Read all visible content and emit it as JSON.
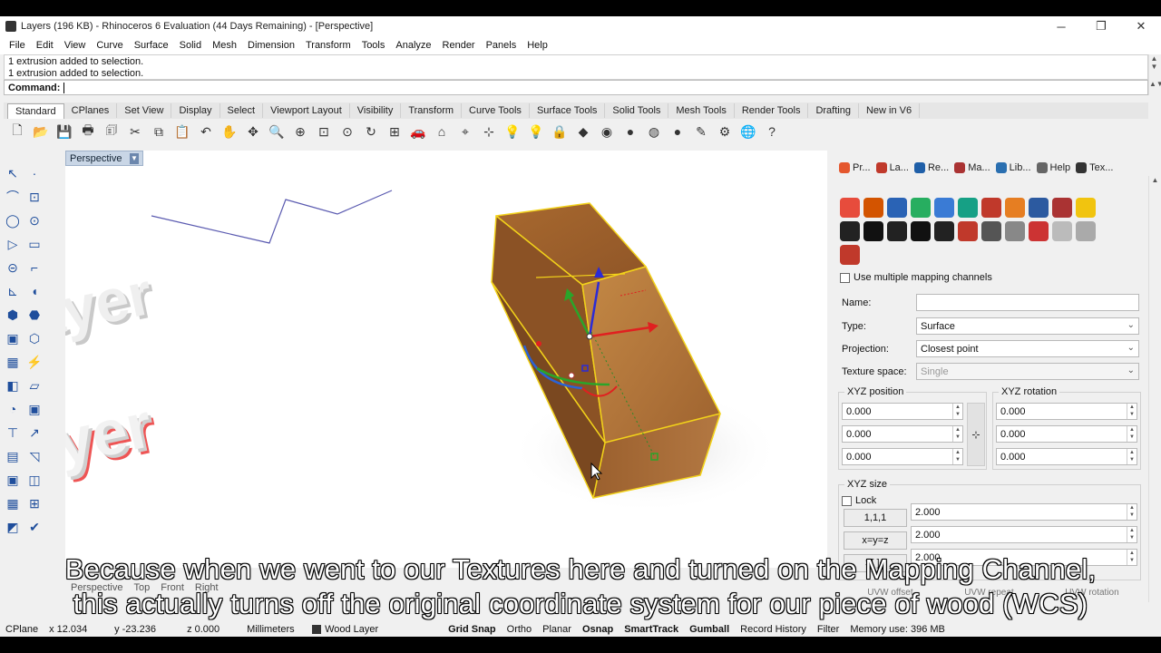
{
  "window": {
    "title": "Layers (196 KB) - Rhinoceros 6 Evaluation (44 Days Remaining) - [Perspective]",
    "minimize": "─",
    "maximize": "❐",
    "close": "✕"
  },
  "menu": [
    "File",
    "Edit",
    "View",
    "Curve",
    "Surface",
    "Solid",
    "Mesh",
    "Dimension",
    "Transform",
    "Tools",
    "Analyze",
    "Render",
    "Panels",
    "Help"
  ],
  "command_history": [
    "1 extrusion added to selection.",
    "1 extrusion added to selection."
  ],
  "command": {
    "label": "Command:",
    "value": ""
  },
  "toolbar_tabs": [
    "Standard",
    "CPlanes",
    "Set View",
    "Display",
    "Select",
    "Viewport Layout",
    "Visibility",
    "Transform",
    "Curve Tools",
    "Surface Tools",
    "Solid Tools",
    "Mesh Tools",
    "Render Tools",
    "Drafting",
    "New in V6"
  ],
  "toolbar_icons": [
    "new-icon",
    "open-icon",
    "save-icon",
    "print-icon",
    "import-icon",
    "cut-icon",
    "copy-icon",
    "paste-icon",
    "undo-icon",
    "pan-icon",
    "rotate-view-icon",
    "zoom-icon",
    "zoom-window-icon",
    "zoom-extents-icon",
    "zoom-selected-icon",
    "rotate-icon",
    "four-views-icon",
    "car-icon",
    "cplane-icon",
    "cplane-world-icon",
    "grid-icon",
    "light-icon",
    "bulb-icon",
    "lock-icon",
    "layer-icon",
    "color-wheel-icon",
    "material-icon",
    "render-icon",
    "sphere-icon",
    "highlight-icon",
    "settings-icon",
    "globe-icon",
    "help-icon"
  ],
  "toolbar_glyphs": [
    "🗋",
    "📂",
    "💾",
    "🖶",
    "🗊",
    "✂",
    "⧉",
    "📋",
    "↶",
    "✋",
    "✥",
    "🔍",
    "⊕",
    "⊡",
    "⊙",
    "↻",
    "⊞",
    "🚗",
    "⌂",
    "⌖",
    "⊹",
    "💡",
    "💡",
    "🔒",
    "◆",
    "◉",
    "●",
    "◍",
    "●",
    "✎",
    "⚙",
    "🌐",
    "?"
  ],
  "left_tools": [
    "↖",
    "·",
    "⌒",
    "⊡",
    "◯",
    "⊙",
    "▷",
    "▭",
    "⊝",
    "⌐",
    "⊾",
    "◖",
    "⬢",
    "⬣",
    "▣",
    "⬡",
    "▦",
    "⚡",
    "◧",
    "▱",
    "◔",
    "▣",
    "⊤",
    "↗",
    "▤",
    "◹",
    "▣",
    "◫",
    "▦",
    "⊞",
    "◩",
    "✔"
  ],
  "viewport": {
    "tab": "Perspective",
    "bottom_tabs": [
      "Perspective",
      "Top",
      "Front",
      "Right"
    ]
  },
  "panel": {
    "tabs": [
      {
        "label": "Pr...",
        "color": "#e4572e"
      },
      {
        "label": "La...",
        "color": "#c0392b"
      },
      {
        "label": "Re...",
        "color": "#1f5fa8"
      },
      {
        "label": "Ma...",
        "color": "#a33"
      },
      {
        "label": "Lib...",
        "color": "#2a6fb0"
      },
      {
        "label": "Help",
        "color": "#666"
      },
      {
        "label": "Tex...",
        "color": "#333"
      }
    ],
    "swatch_colors": [
      "#e74c3c",
      "#d35400",
      "#2a63b5",
      "#27ae60",
      "#3a7bd5",
      "#16a085",
      "#c0392b",
      "#e67e22",
      "#2c5aa0",
      "#a33",
      "#f1c40f",
      "#222",
      "#111",
      "#222",
      "#111",
      "#222",
      "#c0392b",
      "#555",
      "#888",
      "#cc3333",
      "#bbb",
      "#aaa",
      "#c0392b"
    ],
    "use_multiple_channels": "Use multiple mapping channels",
    "name_label": "Name:",
    "name_value": "",
    "type_label": "Type:",
    "type_value": "Surface",
    "projection_label": "Projection:",
    "projection_value": "Closest point",
    "texture_space_label": "Texture space:",
    "texture_space_value": "Single",
    "xyz_position_title": "XYZ position",
    "xyz_position": [
      "0.000",
      "0.000",
      "0.000"
    ],
    "xyz_rotation_title": "XYZ rotation",
    "xyz_rotation": [
      "0.000",
      "0.000",
      "0.000"
    ],
    "xyz_size_title": "XYZ size",
    "lock_label": "Lock",
    "size_buttons": [
      "1,1,1",
      "x=y=z",
      ">[ ]<"
    ],
    "xyz_size": [
      "2.000",
      "2.000",
      "2.000"
    ],
    "uvw_labels": [
      "UVW offset",
      "UVW repeat",
      "UVW rotation"
    ]
  },
  "status": {
    "cplane": "CPlane",
    "x": "x 12.034",
    "y": "y -23.236",
    "z": "z 0.000",
    "units": "Millimeters",
    "layer": "Wood Layer",
    "toggles": [
      "Grid Snap",
      "Ortho",
      "Planar",
      "Osnap",
      "SmartTrack",
      "Gumball",
      "Record History",
      "Filter"
    ],
    "memory": "Memory use: 396 MB"
  },
  "subtitle": {
    "line1": "Because when we went to our Textures here and turned on the Mapping Channel,",
    "line2": "this actually turns off the original coordinate system for our piece of wood (WCS)"
  },
  "scene": {
    "text_upper": "ayer",
    "text_lower": "yer",
    "wood_light": "#b8793c",
    "wood_dark": "#8a5424",
    "select_color": "#f2d21a"
  }
}
